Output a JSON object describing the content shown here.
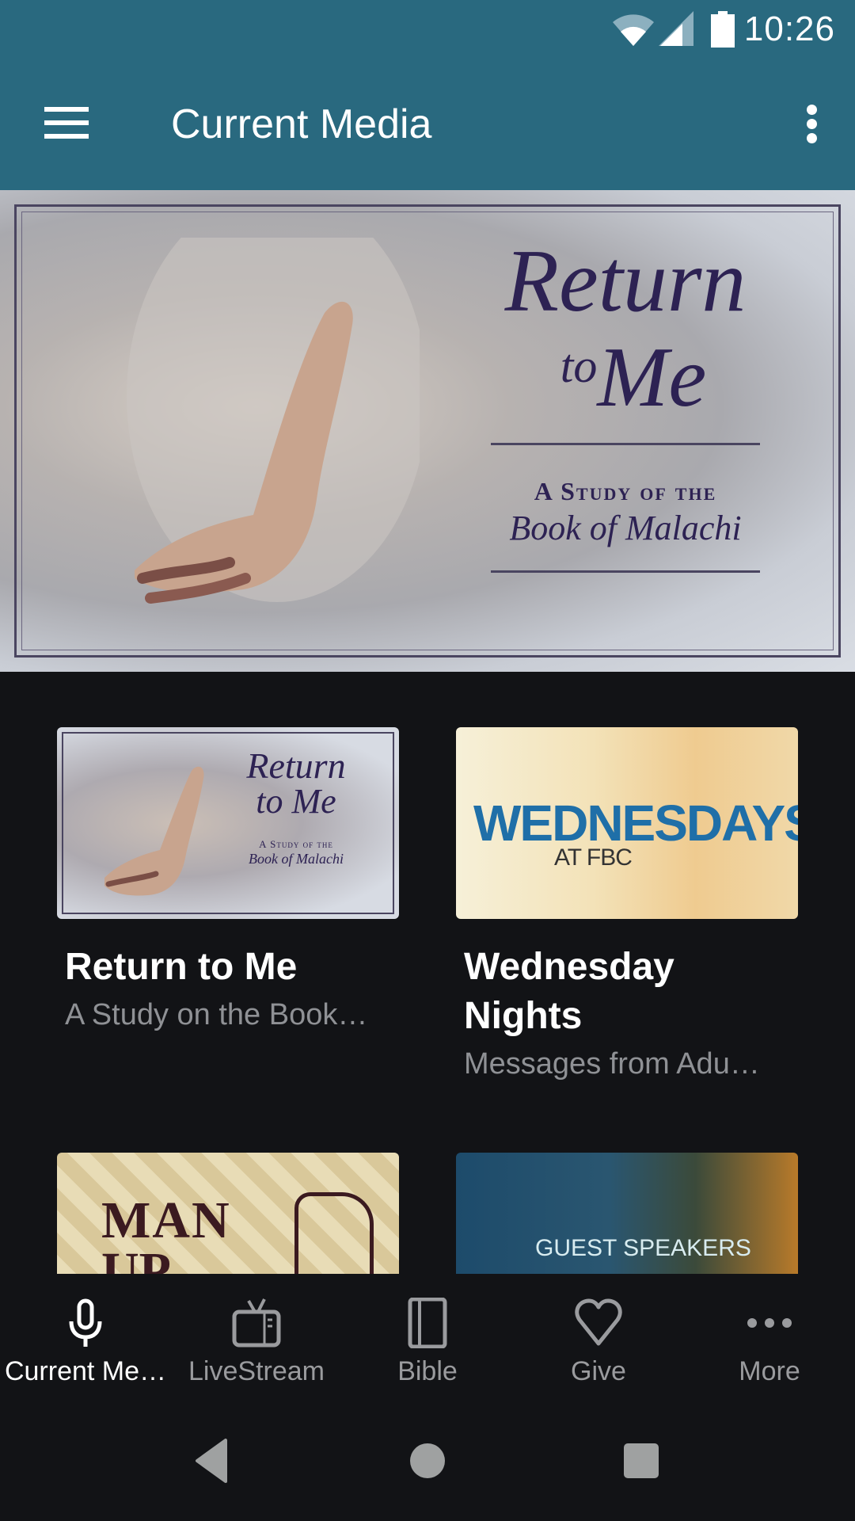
{
  "status_bar": {
    "time": "10:26",
    "icons": [
      "wifi-icon",
      "cell-signal-icon",
      "battery-icon"
    ]
  },
  "app_bar": {
    "title": "Current Media",
    "menu_icon": "hamburger-menu-icon",
    "overflow_icon": "more-vertical-icon"
  },
  "hero": {
    "art_title_line1": "Return",
    "art_title_to": "to",
    "art_title_line2": "Me",
    "art_subtitle_line1": "A Study of the",
    "art_subtitle_line2": "Book of Malachi",
    "carousel": {
      "count": 5,
      "active_index": 0
    }
  },
  "media_items": [
    {
      "title": "Return to Me",
      "subtitle": "A Study on the Book…",
      "art": {
        "line1": "Return",
        "line2": "to Me",
        "line3": "A Study of the",
        "line4": "Book of Malachi"
      }
    },
    {
      "title": "Wednesday Nights",
      "subtitle": "Messages from Adu…",
      "art": {
        "line1": "WEDNESDAYS",
        "line2": "AT FBC"
      }
    },
    {
      "title": "",
      "subtitle": "",
      "art": {
        "line1": "MAN",
        "line2": "UP"
      }
    },
    {
      "title": "",
      "subtitle": "",
      "art": {
        "line1": "GUEST SPEAKERS"
      }
    }
  ],
  "bottom_nav": {
    "items": [
      {
        "label": "Current Me…",
        "icon": "microphone-icon",
        "active": true
      },
      {
        "label": "LiveStream",
        "icon": "tv-icon",
        "active": false
      },
      {
        "label": "Bible",
        "icon": "book-icon",
        "active": false
      },
      {
        "label": "Give",
        "icon": "heart-icon",
        "active": false
      },
      {
        "label": "More",
        "icon": "more-horizontal-icon",
        "active": false
      }
    ]
  },
  "system_nav": {
    "buttons": [
      "back-icon",
      "home-icon",
      "recents-icon"
    ]
  },
  "colors": {
    "primary": "#29697f",
    "background": "#121316",
    "text_primary": "#ffffff",
    "text_secondary": "#8f9195",
    "nav_inactive": "#9a9b9e"
  }
}
